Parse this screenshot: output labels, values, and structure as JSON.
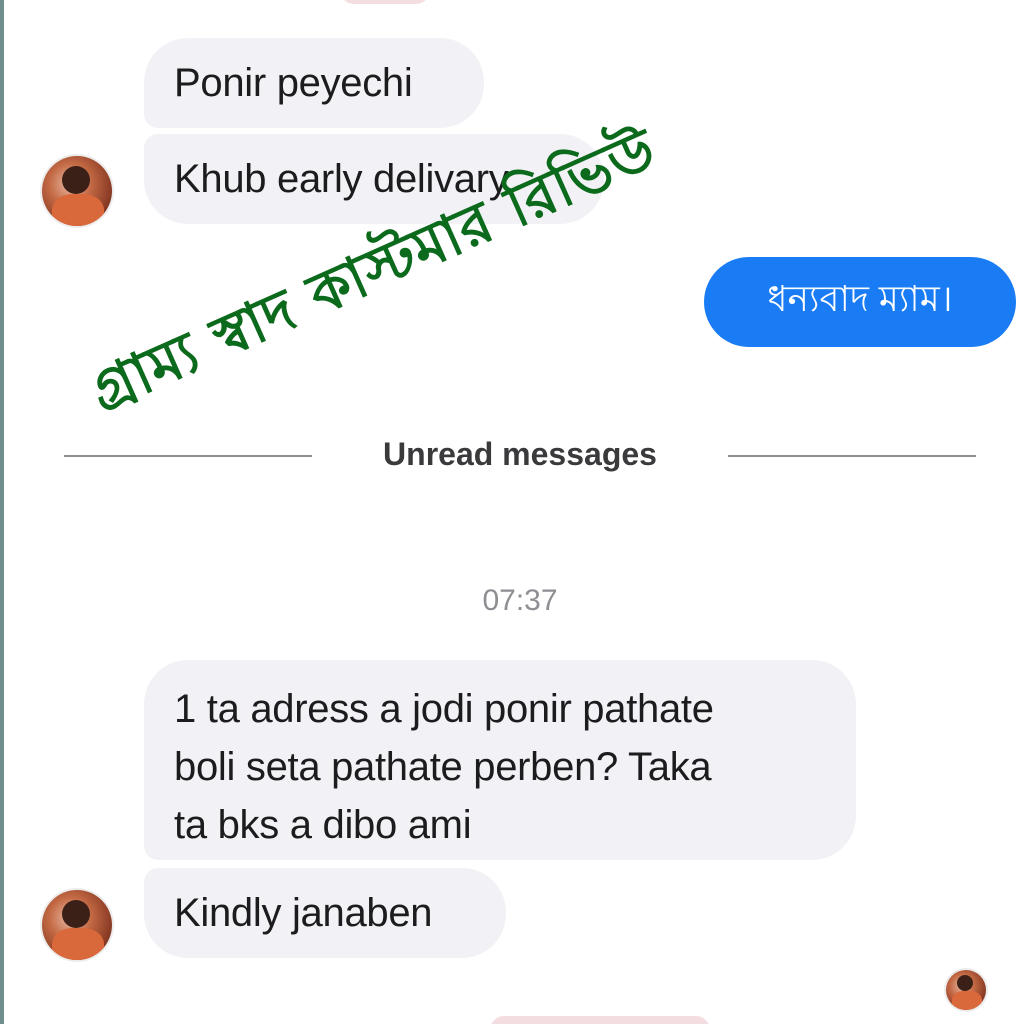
{
  "messages_incoming_1": [
    {
      "text": "Ponir peyechi"
    },
    {
      "text": "Khub early delivary"
    }
  ],
  "message_outgoing": {
    "text": "ধন্যবাদ ম্যাম।"
  },
  "unread_divider": {
    "label": "Unread messages"
  },
  "timestamp": "07:37",
  "messages_incoming_2": [
    {
      "text": "1 ta adress a jodi ponir pathate\nboli seta pathate perben? Taka\nta bks a dibo ami"
    },
    {
      "text": "Kindly janaben"
    }
  ],
  "watermark": {
    "text": "গ্রাম্য স্বাদ কাস্টমার রিভিউ"
  },
  "colors": {
    "outgoing_bubble": "#1a7cf5",
    "incoming_bubble": "#f2f2f6",
    "watermark": "#0c6a1c"
  },
  "icons": {
    "sender_avatar": "avatar-icon"
  }
}
